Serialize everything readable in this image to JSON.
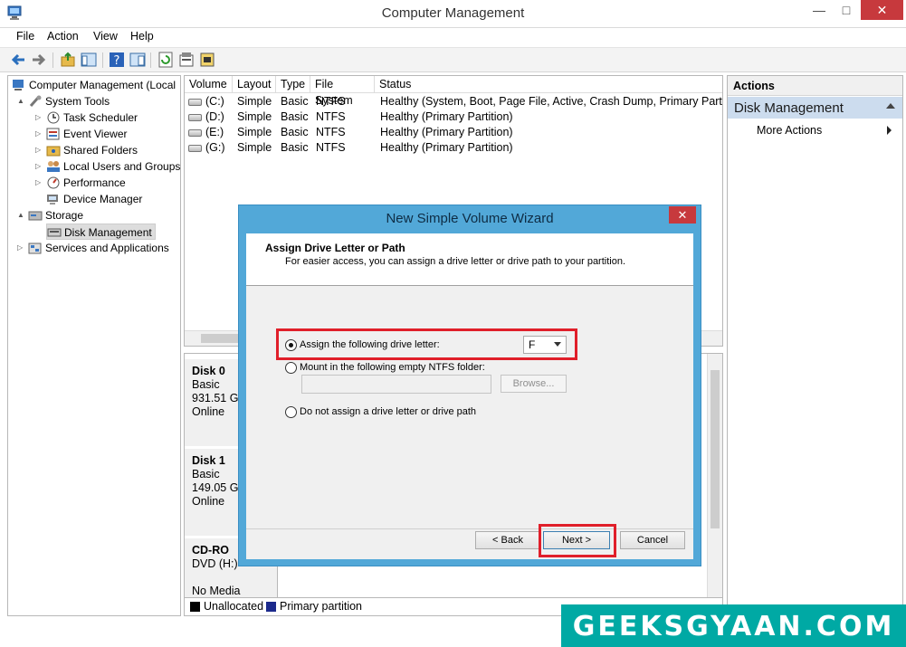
{
  "window": {
    "title": "Computer Management"
  },
  "menu": [
    "File",
    "Action",
    "View",
    "Help"
  ],
  "tree": [
    {
      "label": "Computer Management (Local",
      "depth": 0,
      "expander": ""
    },
    {
      "label": "System Tools",
      "depth": 1,
      "expander": "▲"
    },
    {
      "label": "Task Scheduler",
      "depth": 2,
      "expander": "▷"
    },
    {
      "label": "Event Viewer",
      "depth": 2,
      "expander": "▷"
    },
    {
      "label": "Shared Folders",
      "depth": 2,
      "expander": "▷"
    },
    {
      "label": "Local Users and Groups",
      "depth": 2,
      "expander": "▷"
    },
    {
      "label": "Performance",
      "depth": 2,
      "expander": "▷"
    },
    {
      "label": "Device Manager",
      "depth": 2,
      "expander": ""
    },
    {
      "label": "Storage",
      "depth": 1,
      "expander": "▲"
    },
    {
      "label": "Disk Management",
      "depth": 2,
      "expander": ""
    },
    {
      "label": "Services and Applications",
      "depth": 1,
      "expander": "▷"
    }
  ],
  "volumes": {
    "columns": [
      "Volume",
      "Layout",
      "Type",
      "File System",
      "Status"
    ],
    "rows": [
      [
        "(C:)",
        "Simple",
        "Basic",
        "NTFS",
        "Healthy (System, Boot, Page File, Active, Crash Dump, Primary Partition"
      ],
      [
        "(D:)",
        "Simple",
        "Basic",
        "NTFS",
        "Healthy (Primary Partition)"
      ],
      [
        "(E:)",
        "Simple",
        "Basic",
        "NTFS",
        "Healthy (Primary Partition)"
      ],
      [
        "(G:)",
        "Simple",
        "Basic",
        "NTFS",
        "Healthy (Primary Partition)"
      ]
    ]
  },
  "disks": [
    {
      "name": "Disk 0",
      "type": "Basic",
      "size": "931.51 GB",
      "state": "Online"
    },
    {
      "name": "Disk 1",
      "type": "Basic",
      "size": "149.05 GB",
      "state": "Online"
    },
    {
      "name": "CD-RO",
      "type": "DVD (H:)",
      "size": "",
      "state": "No Media"
    }
  ],
  "legend": {
    "unallocated": "Unallocated",
    "primary": "Primary partition"
  },
  "actions": {
    "header": "Actions",
    "section": "Disk Management",
    "more": "More Actions"
  },
  "wizard": {
    "title": "New Simple Volume Wizard",
    "heading": "Assign Drive Letter or Path",
    "subheading": "For easier access, you can assign a drive letter or drive path to your partition.",
    "opt_assign": "Assign the following drive letter:",
    "drive_letter": "F",
    "opt_mount": "Mount in the following empty NTFS folder:",
    "browse": "Browse...",
    "opt_none": "Do not assign a drive letter or drive path",
    "back": "< Back",
    "next": "Next >",
    "cancel": "Cancel"
  },
  "watermark": "GEEKSGYAAN.COM",
  "colors": {
    "accent": "#52a8d8",
    "highlight": "#e01f2a",
    "close": "#c7393d",
    "primary_partition": "#1c2a8c"
  }
}
